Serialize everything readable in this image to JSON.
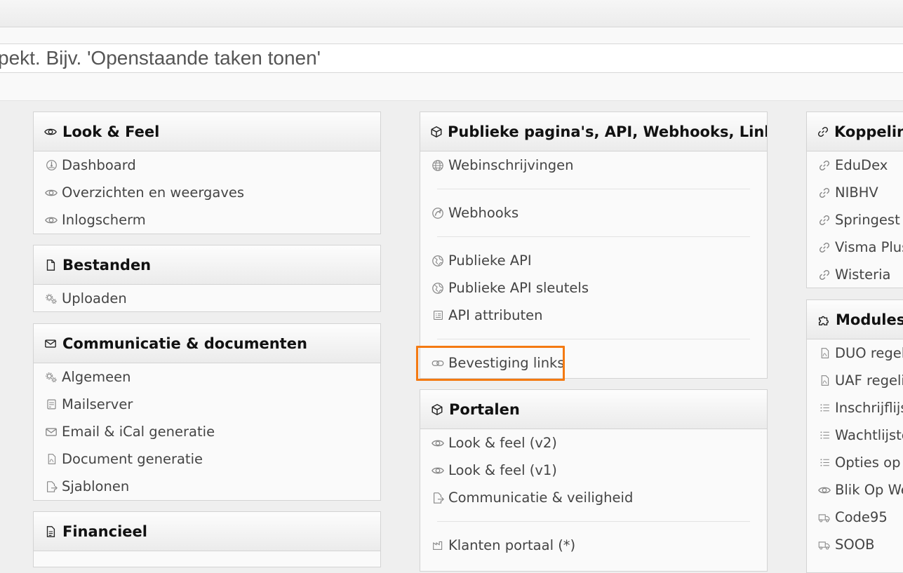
{
  "search": {
    "text": "pekt. Bijv. 'Openstaande taken tonen'"
  },
  "panels": {
    "look": {
      "title": "Look & Feel",
      "icon": "eye-icon",
      "items": [
        {
          "label": "Dashboard",
          "icon": "dashboard-icon"
        },
        {
          "label": "Overzichten en weergaves",
          "icon": "eye-icon"
        },
        {
          "label": "Inlogscherm",
          "icon": "eye-icon"
        }
      ]
    },
    "bestanden": {
      "title": "Bestanden",
      "icon": "file-icon",
      "items": [
        {
          "label": "Uploaden",
          "icon": "gears-icon"
        }
      ]
    },
    "comm": {
      "title": "Communicatie & documenten",
      "icon": "envelope-icon",
      "items": [
        {
          "label": "Algemeen",
          "icon": "gears-icon"
        },
        {
          "label": "Mailserver",
          "icon": "server-icon"
        },
        {
          "label": "Email & iCal generatie",
          "icon": "envelope-icon"
        },
        {
          "label": "Document generatie",
          "icon": "file-pdf-icon"
        },
        {
          "label": "Sjablonen",
          "icon": "file-export-icon"
        }
      ]
    },
    "fin": {
      "title": "Financieel",
      "icon": "file-text-icon"
    },
    "publiek": {
      "title": "Publieke pagina's, API, Webhooks, Links",
      "icon": "cube-icon",
      "items": [
        {
          "label": "Webinschrijvingen",
          "icon": "globe-icon"
        },
        {
          "label": "Webhooks",
          "icon": "webhook-icon"
        },
        {
          "label": "Publieke API",
          "icon": "api-globe-icon"
        },
        {
          "label": "Publieke API sleutels",
          "icon": "api-globe-icon"
        },
        {
          "label": "API attributen",
          "icon": "list-box-icon"
        },
        {
          "label": "Bevestiging links",
          "icon": "link-icon"
        }
      ]
    },
    "portalen": {
      "title": "Portalen",
      "icon": "cube-icon",
      "items": [
        {
          "label": "Look & feel (v2)",
          "icon": "eye-icon"
        },
        {
          "label": "Look & feel (v1)",
          "icon": "eye-icon"
        },
        {
          "label": "Communicatie & veiligheid",
          "icon": "file-export-icon"
        },
        {
          "label": "Klanten portaal (*)",
          "icon": "factory-icon"
        }
      ]
    },
    "koppelingen": {
      "title": "Koppeling",
      "icon": "link-icon",
      "items": [
        {
          "label": "EduDex",
          "icon": "link-icon"
        },
        {
          "label": "NIBHV",
          "icon": "link-icon"
        },
        {
          "label": "Springest",
          "icon": "link-icon"
        },
        {
          "label": "Visma Plus",
          "icon": "link-icon"
        },
        {
          "label": "Wisteria",
          "icon": "link-icon"
        }
      ]
    },
    "modules": {
      "title": "Modules",
      "icon": "puzzle-icon",
      "items": [
        {
          "label": "DUO regeli",
          "icon": "file-pdf-icon"
        },
        {
          "label": "UAF regelir",
          "icon": "file-pdf-icon"
        },
        {
          "label": "Inschrijflijs",
          "icon": "list-icon"
        },
        {
          "label": "Wachtlijste",
          "icon": "list-icon"
        },
        {
          "label": "Opties op",
          "icon": "list-icon"
        },
        {
          "label": "Blik Op We",
          "icon": "eye-icon"
        },
        {
          "label": "Code95",
          "icon": "truck-icon"
        },
        {
          "label": "SOOB",
          "icon": "truck-icon"
        }
      ]
    }
  },
  "colors": {
    "highlight": "#f47a12",
    "panel_bg": "#fafafa",
    "page_bg": "#efefef"
  }
}
